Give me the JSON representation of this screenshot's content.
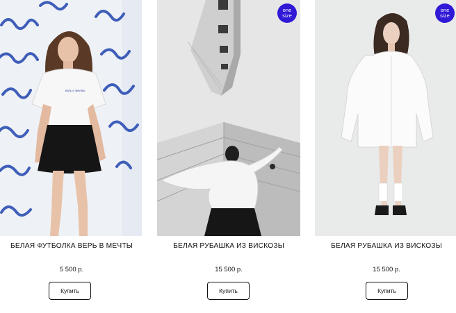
{
  "products": [
    {
      "title": "БЕЛАЯ ФУТБОЛКА ВЕРЬ В МЕЧТЫ",
      "price": "5 500 р.",
      "button_label": "Купить",
      "image_alt": "Model in white t-shirt and black skirt"
    },
    {
      "title": "БЕЛАЯ РУБАШКА ИЗ ВИСКОЗЫ",
      "price": "15 500 р.",
      "button_label": "Купить",
      "badge_line1": "one",
      "badge_line2": "size",
      "image_alt": "Model in white shirt between buildings"
    },
    {
      "title": "БЕЛАЯ РУБАШКА ИЗ ВИСКОЗЫ",
      "price": "15 500 р.",
      "button_label": "Купить",
      "badge_line1": "one",
      "badge_line2": "size",
      "image_alt": "Model in oversized white shirt"
    }
  ],
  "colors": {
    "badge": "#3019d6",
    "background": "#ffffff",
    "text": "#111111"
  }
}
